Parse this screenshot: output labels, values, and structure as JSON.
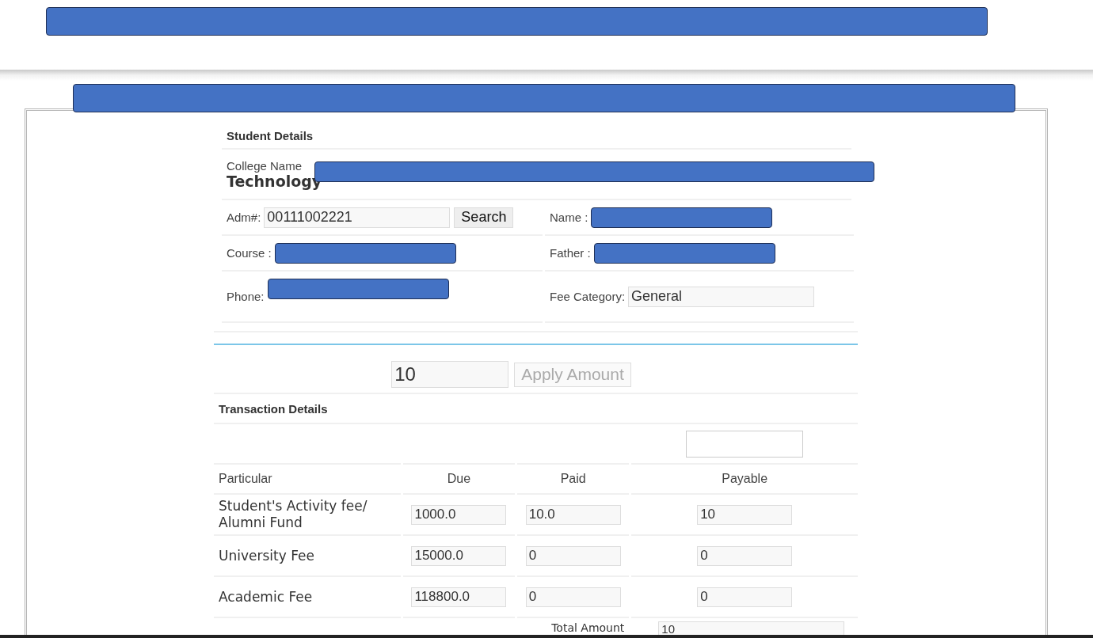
{
  "student_details": {
    "title": "Student Details",
    "college": {
      "label": "College Name",
      "value": "Technology"
    },
    "fields": [
      {
        "label": "Adm#:",
        "value": "00111002221",
        "button": "Search"
      },
      {
        "label": "Name :"
      },
      {
        "label": "Course :"
      },
      {
        "label": "Father :"
      },
      {
        "label": "Phone:"
      },
      {
        "label": "Fee Category:",
        "value": "General"
      }
    ]
  },
  "apply": {
    "amount": "10",
    "button": "Apply Amount",
    "disabled": true
  },
  "transaction": {
    "title": "Transaction Details",
    "columns": [
      "Particular",
      "Due",
      "Paid",
      "Payable"
    ],
    "rows": [
      {
        "particular": "Student's Activity fee/ Alumni Fund",
        "due": "1000.0",
        "paid": "10.0",
        "payable": "10"
      },
      {
        "particular": "University Fee",
        "due": "15000.0",
        "paid": "0",
        "payable": "0"
      },
      {
        "particular": "Academic Fee",
        "due": "118800.0",
        "paid": "0",
        "payable": "0"
      }
    ],
    "total": {
      "label": "Total Amount",
      "value": "10"
    }
  }
}
